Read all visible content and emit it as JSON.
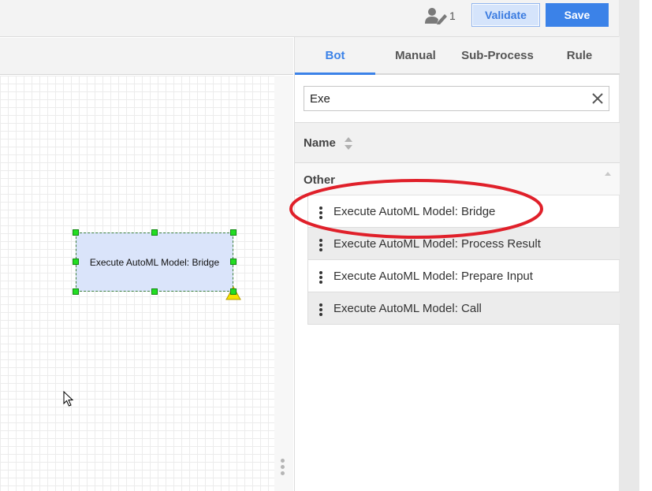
{
  "header": {
    "user_count": "1",
    "validate_label": "Validate",
    "save_label": "Save"
  },
  "canvas": {
    "node_label": "Execute AutoML Model: Bridge"
  },
  "panel": {
    "tabs": [
      {
        "label": "Bot",
        "active": true
      },
      {
        "label": "Manual",
        "active": false
      },
      {
        "label": "Sub-Process",
        "active": false
      },
      {
        "label": "Rule",
        "active": false
      }
    ],
    "search": {
      "value": "Exe"
    },
    "column_header": "Name",
    "group": "Other",
    "items": [
      {
        "label": "Execute AutoML Model: Bridge"
      },
      {
        "label": "Execute AutoML Model: Process Result"
      },
      {
        "label": "Execute AutoML Model: Prepare Input"
      },
      {
        "label": "Execute AutoML Model: Call"
      }
    ]
  },
  "colors": {
    "accent": "#3b82e8",
    "annotation": "#e0202a",
    "node_fill": "#dae4fa",
    "handle": "#22dd22"
  },
  "icons": [
    "user-edit-icon",
    "clear-icon",
    "sort-icon",
    "collapse-icon",
    "drag-handle-icon",
    "warning-icon",
    "mouse-cursor-icon"
  ]
}
